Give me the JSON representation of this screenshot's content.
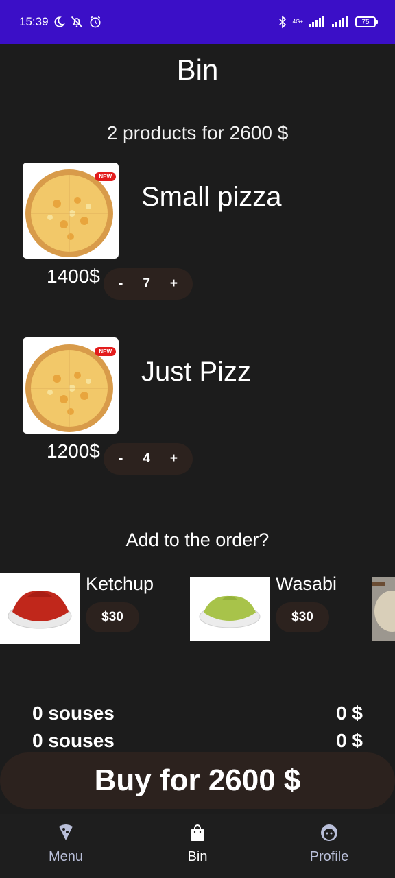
{
  "status_bar": {
    "time": "15:39",
    "network": "4G+",
    "battery": "75"
  },
  "header": {
    "title": "Bin"
  },
  "cart": {
    "summary": "2 products for 2600 $",
    "items": [
      {
        "name": "Small pizza",
        "price": "1400$",
        "quantity": "7",
        "minus": "-",
        "plus": "+",
        "badge": "NEW"
      },
      {
        "name": "Just Pizz",
        "price": "1200$",
        "quantity": "4",
        "minus": "-",
        "plus": "+",
        "badge": "NEW"
      }
    ]
  },
  "addons": {
    "title": "Add to the order?",
    "items": [
      {
        "name": "Ketchup",
        "price": "$30",
        "color": "#c0271b"
      },
      {
        "name": "Wasabi",
        "price": "$30",
        "color": "#a8c34a"
      }
    ]
  },
  "totals": [
    {
      "label": "0 souses",
      "value": "0 $"
    },
    {
      "label": "0 souses",
      "value": "0 $"
    }
  ],
  "buy_button": {
    "label": "Buy for 2600 $"
  },
  "bottom_nav": {
    "items": [
      {
        "label": "Menu",
        "icon": "pizza-icon",
        "active": false
      },
      {
        "label": "Bin",
        "icon": "bag-icon",
        "active": true
      },
      {
        "label": "Profile",
        "icon": "face-icon",
        "active": false
      }
    ]
  }
}
